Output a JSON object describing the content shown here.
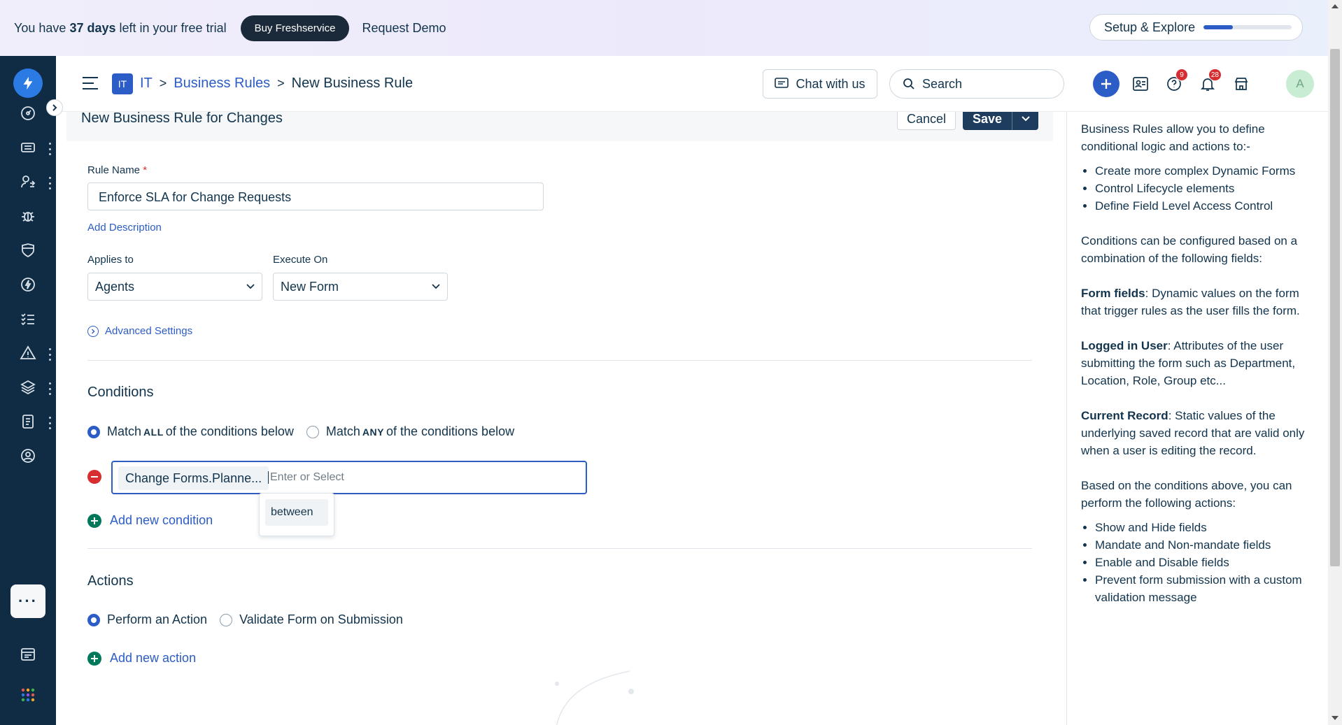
{
  "trial": {
    "prefix": "You have",
    "days": "37 days",
    "suffix": "left in your free trial",
    "buy_label": "Buy Freshservice",
    "demo_label": "Request Demo",
    "setup_label": "Setup & Explore",
    "setup_progress": 0.33
  },
  "header": {
    "workspace_badge": "IT",
    "breadcrumb": [
      "IT",
      "Business Rules",
      "New Business Rule"
    ],
    "chat_label": "Chat with us",
    "search_label": "Search",
    "help_badge": "9",
    "notif_badge": "28",
    "avatar_initial": "A"
  },
  "form": {
    "title": "New Business Rule for Changes",
    "cancel_label": "Cancel",
    "save_label": "Save",
    "rule_name_label": "Rule Name",
    "required_mark": "*",
    "rule_name_value": "Enforce SLA for Change Requests",
    "add_description": "Add Description",
    "applies_to_label": "Applies to",
    "applies_to_value": "Agents",
    "execute_on_label": "Execute On",
    "execute_on_value": "New Form",
    "advanced_settings": "Advanced Settings"
  },
  "conditions": {
    "title": "Conditions",
    "match_all": {
      "pre": "Match",
      "key": "ALL",
      "post": "of the conditions below"
    },
    "match_any": {
      "pre": "Match",
      "key": "ANY",
      "post": "of the conditions below"
    },
    "field_value": "Change Forms.Planne...",
    "operator_placeholder": "Enter or Select",
    "dropdown_options": [
      "between"
    ],
    "add_label": "Add new condition"
  },
  "actions": {
    "title": "Actions",
    "perform_label": "Perform an Action",
    "validate_label": "Validate Form on Submission",
    "add_label": "Add new action"
  },
  "help": {
    "intro": "Business Rules allow you to define conditional logic and actions to:-",
    "list1": [
      "Create more complex Dynamic Forms",
      "Control Lifecycle elements",
      "Define Field Level Access Control"
    ],
    "conditions_intro": "Conditions can be configured based on a combination of the following fields:",
    "form_fields_key": "Form fields",
    "form_fields_text": ": Dynamic values on the form that trigger rules as the user fills the form.",
    "logged_user_key": "Logged in User",
    "logged_user_text": ": Attributes of the user submitting the form such as Department, Location, Role, Group etc...",
    "current_record_key": "Current Record",
    "current_record_text": ": Static values of the underlying saved record that are valid only when a user is editing the record.",
    "actions_intro": "Based on the conditions above, you can perform the following actions:",
    "list2": [
      "Show and Hide fields",
      "Mandate and Non-mandate fields",
      "Enable and Disable fields",
      "Prevent form submission with a custom validation message"
    ]
  },
  "colors": {
    "accent": "#2c5cc5",
    "nav_bg": "#0f2c44",
    "danger": "#d72d30",
    "success": "#00795b"
  }
}
